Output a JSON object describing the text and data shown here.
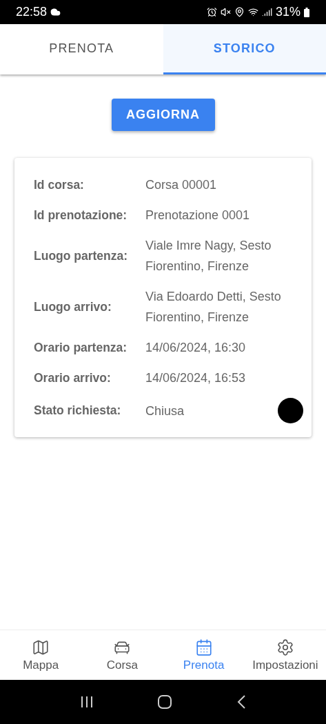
{
  "status_bar": {
    "time": "22:58",
    "battery": "31%"
  },
  "tabs": [
    {
      "label": "PRENOTA",
      "selected": false
    },
    {
      "label": "STORICO",
      "selected": true
    }
  ],
  "refresh_button": "AGGIORNA",
  "ride": {
    "fields": [
      {
        "label": "Id corsa:",
        "value": "Corsa 00001"
      },
      {
        "label": "Id prenotazione:",
        "value": "Prenotazione 0001"
      },
      {
        "label": "Luogo partenza:",
        "value": "Viale Imre Nagy, Sesto Fiorentino, Firenze"
      },
      {
        "label": "Luogo arrivo:",
        "value": "Via Edoardo Detti, Sesto Fiorentino, Firenze"
      },
      {
        "label": "Orario partenza:",
        "value": "14/06/2024, 16:30"
      },
      {
        "label": "Orario arrivo:",
        "value": "14/06/2024, 16:53"
      },
      {
        "label": "Stato richiesta:",
        "value": "Chiusa",
        "color": "#000000"
      }
    ]
  },
  "bottom_nav": [
    {
      "label": "Mappa",
      "kind": "map",
      "selected": false
    },
    {
      "label": "Corsa",
      "kind": "car",
      "selected": false
    },
    {
      "label": "Prenota",
      "kind": "calendar",
      "selected": true
    },
    {
      "label": "Impostazioni",
      "kind": "settings",
      "selected": false
    }
  ]
}
